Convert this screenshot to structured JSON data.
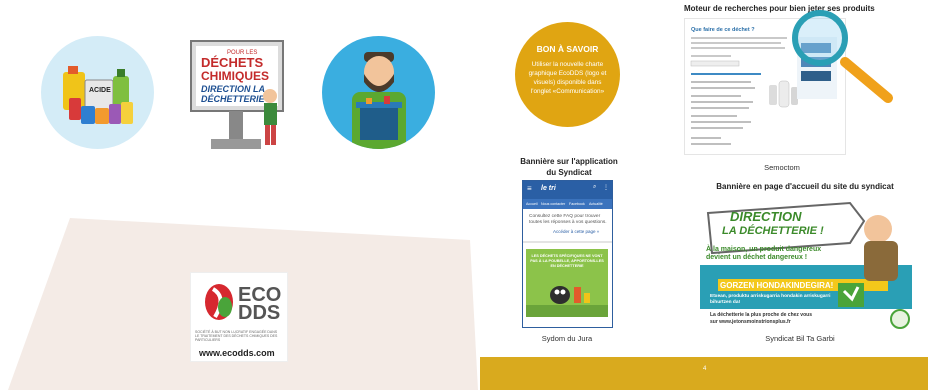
{
  "left": {
    "icons": [
      {
        "name": "household-chemicals-icon",
        "bg": "#d4ecf7"
      },
      {
        "name": "chemical-waste-sign-icon",
        "bg": "#ffffff",
        "title_line1": "POUR LES",
        "title_line2": "DÉCHETS",
        "title_line3": "CHIMIQUES",
        "subtitle_line1": "DIRECTION LA",
        "subtitle_line2": "DÉCHETTERIE"
      },
      {
        "name": "recycling-worker-icon",
        "bg": "#3aaee0"
      }
    ],
    "logo": {
      "brand_line1": "ECO",
      "brand_line2": "DDS",
      "tagline": "SOCIÉTÉ À BUT NON LUCRATIF ENGAGÉE DANS LE TRAITEMENT DES DÉCHETS CHIMIQUES DES PARTICULIERS",
      "url": "www.ecodds.com"
    }
  },
  "right": {
    "savoir": {
      "title": "BON À SAVOIR",
      "text": "Utiliser la nouvelle charte graphique EcoDDS (logo et visuels) disponible dans l'onglet «Communication»"
    },
    "search_engine": {
      "heading": "Moteur de recherches pour bien jeter ses produits",
      "page_title": "Que faire de ce déchet ?",
      "caption": "Semoctom"
    },
    "app_banner": {
      "heading_line1": "Bannière sur l'application",
      "heading_line2": "du Syndicat",
      "app_name": "le tri",
      "tabs": [
        "Accueil",
        "Nous contacter",
        "Facebook",
        "Actualité"
      ],
      "body_text": "Consultez cette FAQ pour trouver toutes les réponses à vos questions.",
      "link_text": "Accéder à cette page »",
      "poster_text": "LES DÉCHETS SPÉCIFIQUES NE VONT PAS À LA POUBELLE, APPORTONS-LES EN DÉCHETTERIE",
      "caption": "Sydom du Jura"
    },
    "site_banner": {
      "heading": "Bannière en page d'accueil du site du syndicat",
      "sign_line1": "DIRECTION",
      "sign_line2": "LA DÉCHETTERIE !",
      "warning": "À la maison, un produit dangereux devient un déchet dangereux !",
      "basque_title": "GORZEN HONDAKINDEGIRA!",
      "basque_text": "Etxean, produktu arriskugarria hondakin arriskugarri bihurtzen da!",
      "footer_line1": "La déchetterie la plus proche de chez vous",
      "footer_line2": "sur www.jetonsmoinstrionsplus.fr",
      "caption": "Syndicat Bil Ta Garbi"
    },
    "page_number": "4"
  },
  "colors": {
    "gold": "#e0a512",
    "footer": "#d9aa1e",
    "beige": "#f4ebe6",
    "green": "#4aa43a",
    "teal": "#2a9fb5"
  }
}
